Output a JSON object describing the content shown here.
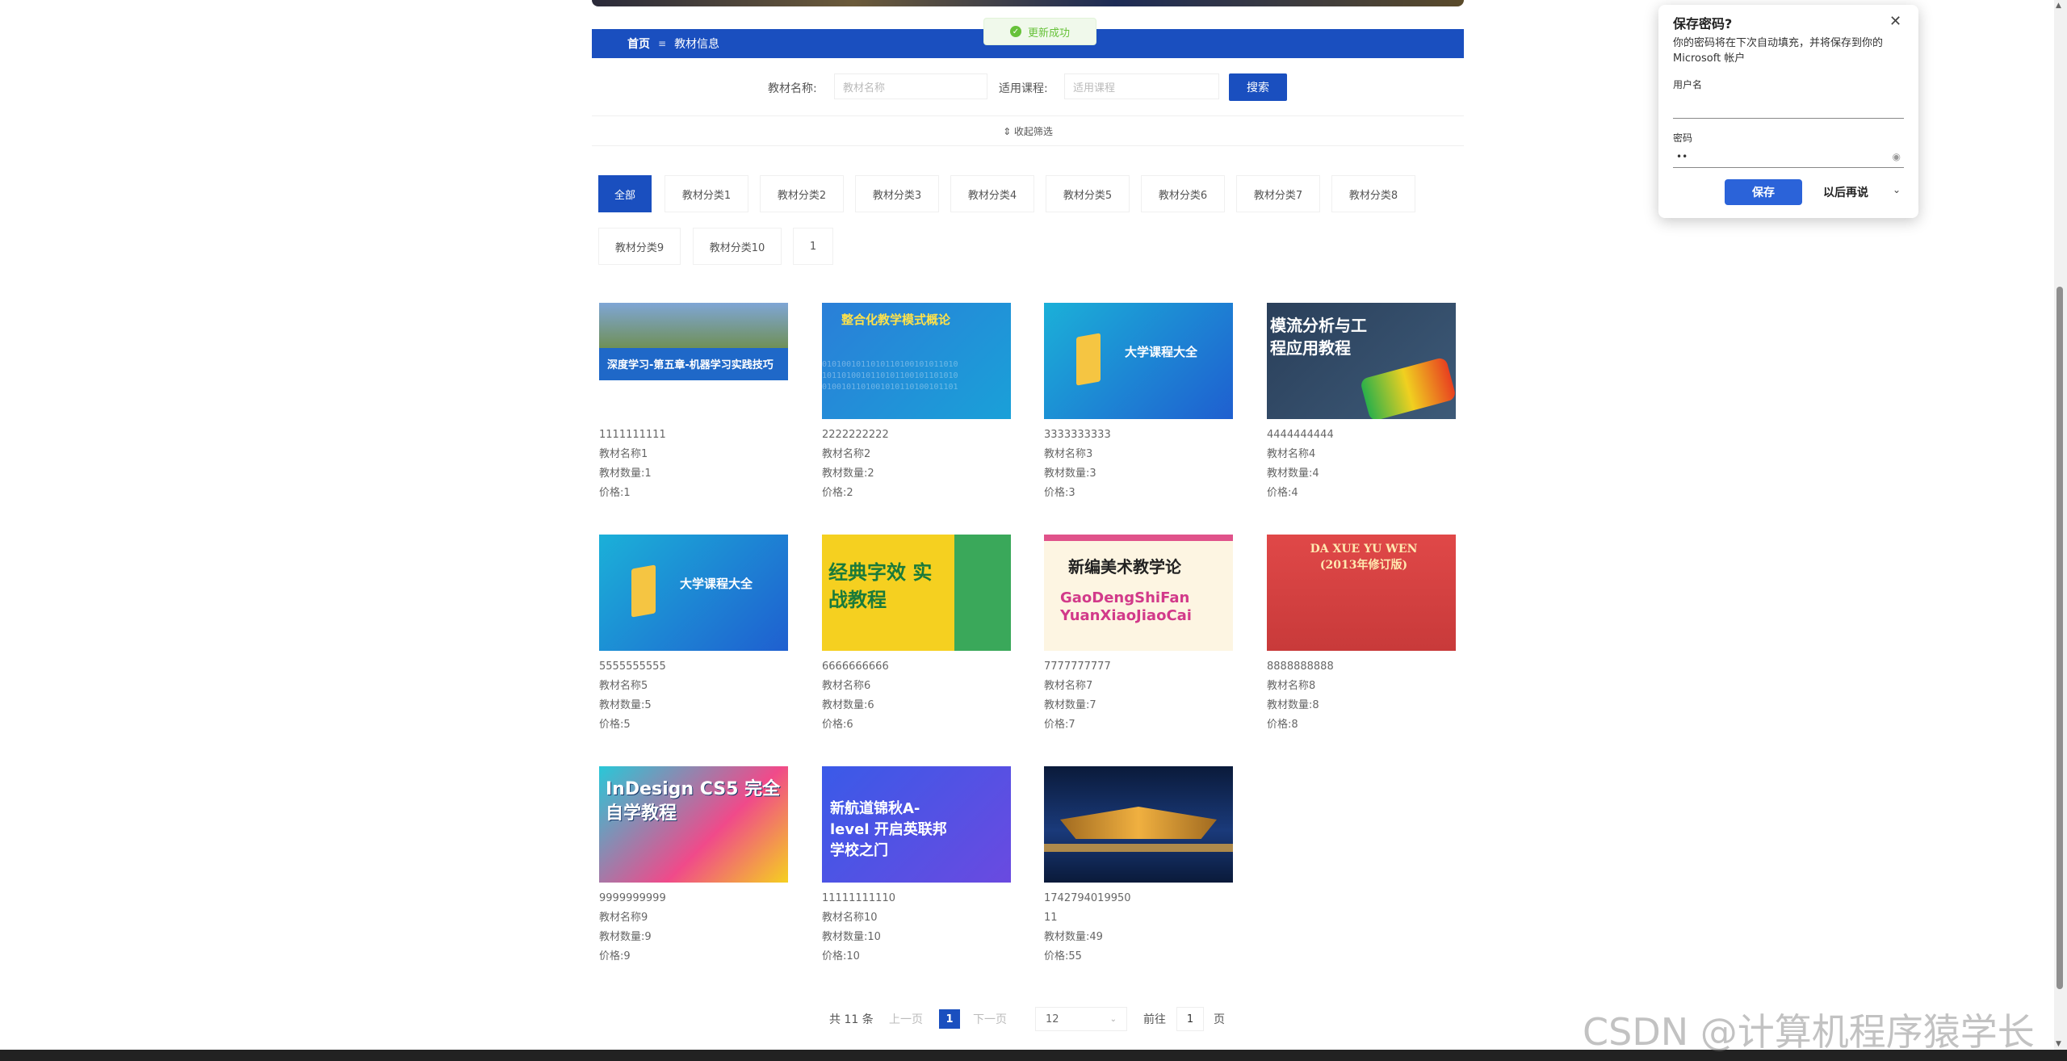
{
  "toast": {
    "text": "更新成功"
  },
  "breadcrumb": {
    "home": "首页",
    "sep": "≡",
    "current": "教材信息"
  },
  "search": {
    "name_label": "教材名称:",
    "name_placeholder": "教材名称",
    "course_label": "适用课程:",
    "course_placeholder": "适用课程",
    "button": "搜索"
  },
  "collapse": {
    "label": "⇕ 收起筛选"
  },
  "categories": [
    "全部",
    "教材分类1",
    "教材分类2",
    "教材分类3",
    "教材分类4",
    "教材分类5",
    "教材分类6",
    "教材分类7",
    "教材分类8",
    "教材分类9",
    "教材分类10",
    "1"
  ],
  "cards": [
    {
      "code": "1111111111",
      "name": "教材名称1",
      "qty": "教材数量:1",
      "price": "价格:1",
      "img_text": "深度学习-第五章-机器学习实践技巧"
    },
    {
      "code": "2222222222",
      "name": "教材名称2",
      "qty": "教材数量:2",
      "price": "价格:2",
      "img_text": "整合化教学模式概论"
    },
    {
      "code": "3333333333",
      "name": "教材名称3",
      "qty": "教材数量:3",
      "price": "价格:3",
      "img_text": "大学课程大全"
    },
    {
      "code": "4444444444",
      "name": "教材名称4",
      "qty": "教材数量:4",
      "price": "价格:4",
      "img_text": "模流分析与工程应用教程"
    },
    {
      "code": "5555555555",
      "name": "教材名称5",
      "qty": "教材数量:5",
      "price": "价格:5",
      "img_text": "大学课程大全"
    },
    {
      "code": "6666666666",
      "name": "教材名称6",
      "qty": "教材数量:6",
      "price": "价格:6",
      "img_text": "经典字效 实战教程"
    },
    {
      "code": "7777777777",
      "name": "教材名称7",
      "qty": "教材数量:7",
      "price": "价格:7",
      "img_text": "新编美术教学论"
    },
    {
      "code": "8888888888",
      "name": "教材名称8",
      "qty": "教材数量:8",
      "price": "价格:8",
      "img_text": "DA XUE YU WEN (2013年修订版)"
    },
    {
      "code": "9999999999",
      "name": "教材名称9",
      "qty": "教材数量:9",
      "price": "价格:9",
      "img_text": "InDesign CS5 完全自学教程"
    },
    {
      "code": "11111111110",
      "name": "教材名称10",
      "qty": "教材数量:10",
      "price": "价格:10",
      "img_text": "新航道锦秋A-level 开启英联邦学校之门"
    },
    {
      "code": "1742794019950",
      "name": "11",
      "qty": "教材数量:49",
      "price": "价格:55",
      "img_text": ""
    }
  ],
  "pagination": {
    "total": "共 11 条",
    "prev": "上一页",
    "current": "1",
    "next": "下一页",
    "page_size": "12",
    "goto_label": "前往",
    "goto_value": "1",
    "page_unit": "页"
  },
  "password_popup": {
    "title": "保存密码?",
    "desc": "你的密码将在下次自动填充，并将保存到你的 Microsoft 帐户",
    "username_label": "用户名",
    "password_label": "密码",
    "password_value": "••",
    "save": "保存",
    "later": "以后再说"
  },
  "watermark": "CSDN @计算机程序猿学长"
}
